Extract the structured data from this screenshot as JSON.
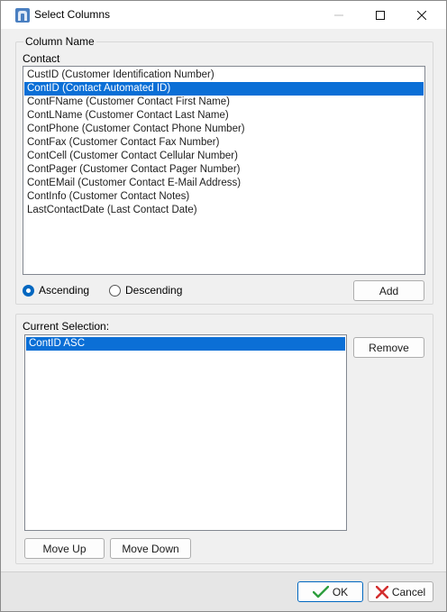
{
  "window": {
    "title": "Select Columns",
    "app_icon": "app-icon",
    "controls": [
      "minimize-icon",
      "maximize-icon",
      "close-icon"
    ]
  },
  "column_group": {
    "legend": "Column Name",
    "table_label": "Contact",
    "items": [
      {
        "text": "CustID  (Customer Identification Number)",
        "selected": false
      },
      {
        "text": "ContID  (Contact Automated ID)",
        "selected": true
      },
      {
        "text": "ContFName  (Customer Contact First Name)",
        "selected": false
      },
      {
        "text": "ContLName  (Customer Contact Last Name)",
        "selected": false
      },
      {
        "text": "ContPhone  (Customer Contact Phone Number)",
        "selected": false
      },
      {
        "text": "ContFax  (Customer Contact Fax Number)",
        "selected": false
      },
      {
        "text": "ContCell  (Customer Contact Cellular Number)",
        "selected": false
      },
      {
        "text": "ContPager  (Customer Contact Pager Number)",
        "selected": false
      },
      {
        "text": "ContEMail  (Customer Contact E-Mail Address)",
        "selected": false
      },
      {
        "text": "ContInfo  (Customer Contact Notes)",
        "selected": false
      },
      {
        "text": "LastContactDate  (Last Contact Date)",
        "selected": false
      }
    ],
    "sort": {
      "ascending_label": "Ascending",
      "descending_label": "Descending",
      "selected": "ascending"
    },
    "add_label": "Add"
  },
  "selection_group": {
    "label": "Current Selection:",
    "items": [
      {
        "text": "ContID ASC",
        "selected": true
      }
    ],
    "remove_label": "Remove",
    "move_up_label": "Move Up",
    "move_down_label": "Move Down"
  },
  "footer": {
    "ok_label": "OK",
    "cancel_label": "Cancel"
  },
  "colors": {
    "selection": "#0b6fd6",
    "ok_check": "#2e9e3e",
    "cancel_x": "#d32f2f",
    "accent": "#0067c0"
  }
}
